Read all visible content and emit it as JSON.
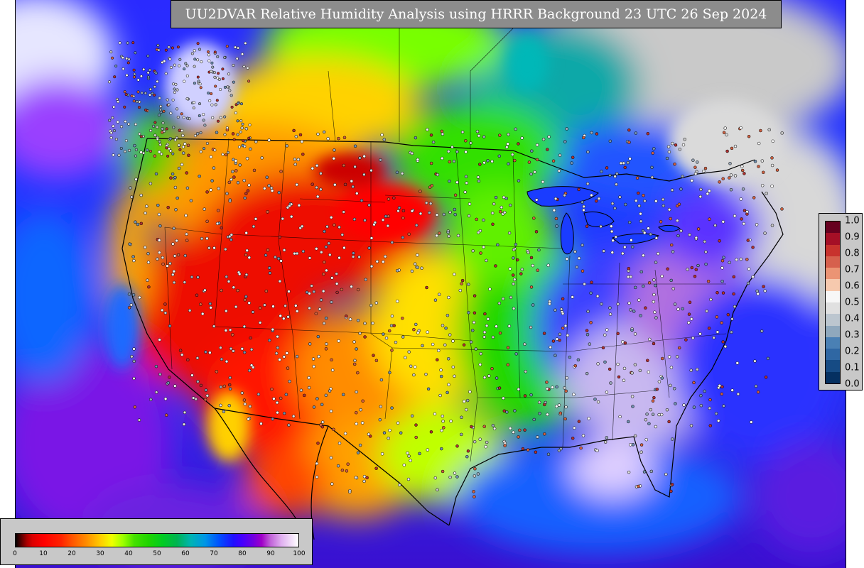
{
  "title": "UU2DVAR Relative Humidity Analysis using HRRR Background 23 UTC 26 Sep 2024",
  "bottom_colorbar": {
    "ticks": [
      "0",
      "10",
      "20",
      "30",
      "40",
      "50",
      "60",
      "70",
      "80",
      "90",
      "100"
    ],
    "tick_values": [
      0,
      10,
      20,
      30,
      40,
      50,
      60,
      70,
      80,
      90,
      100
    ]
  },
  "right_colorbar": {
    "ticks": [
      "1.0",
      "0.9",
      "0.8",
      "0.7",
      "0.6",
      "0.5",
      "0.4",
      "0.3",
      "0.2",
      "0.1",
      "0.0"
    ],
    "tick_values": [
      1.0,
      0.9,
      0.8,
      0.7,
      0.6,
      0.5,
      0.4,
      0.3,
      0.2,
      0.1,
      0.0
    ],
    "colors": [
      "#67001f",
      "#a50f26",
      "#c8322d",
      "#d6604d",
      "#eb9474",
      "#f6c9ae",
      "#f7f7f7",
      "#e0e0e0",
      "#bcc6cf",
      "#8fa8bd",
      "#4a80b4",
      "#2f67a3",
      "#164b84",
      "#053061"
    ]
  },
  "colors": {
    "ocean_blue": "#1238ff",
    "canada_snow": "#c9c9c9",
    "dry_red": "#ff0000",
    "moist_green": "#22d400"
  }
}
